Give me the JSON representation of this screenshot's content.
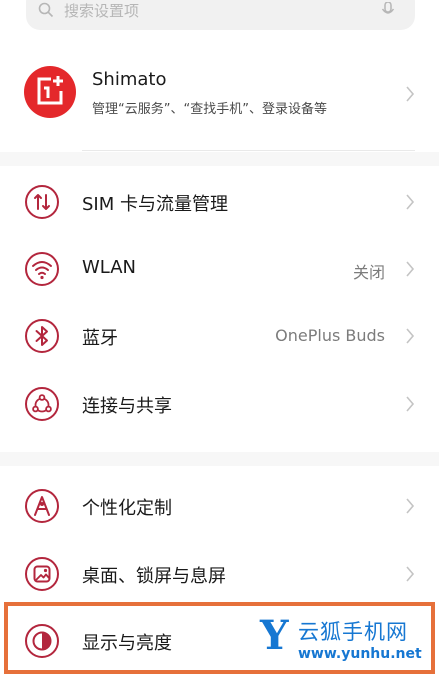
{
  "search": {
    "placeholder": "搜索设置项"
  },
  "account": {
    "name": "Shimato",
    "subtitle": "管理“云服务”、“查找手机”、登录设备等"
  },
  "items": [
    {
      "label": "SIM 卡与流量管理",
      "value": "",
      "icon": "sim-card-icon"
    },
    {
      "label": "WLAN",
      "value": "关闭",
      "icon": "wifi-icon"
    },
    {
      "label": "蓝牙",
      "value": "OnePlus Buds",
      "icon": "bluetooth-icon"
    },
    {
      "label": "连接与共享",
      "value": "",
      "icon": "connection-sharing-icon"
    },
    {
      "label": "个性化定制",
      "value": "",
      "icon": "personalization-icon"
    },
    {
      "label": "桌面、锁屏与息屏",
      "value": "",
      "icon": "wallpaper-icon"
    },
    {
      "label": "显示与亮度",
      "value": "",
      "icon": "display-brightness-icon"
    }
  ],
  "watermark": {
    "letter": "Y",
    "brand": "云狐手机网",
    "url": "www.yunhu.net"
  },
  "colors": {
    "accent": "#b3263d",
    "logo": "#e4282b",
    "highlight": "#e6703a",
    "watermark": "#1677d2"
  }
}
